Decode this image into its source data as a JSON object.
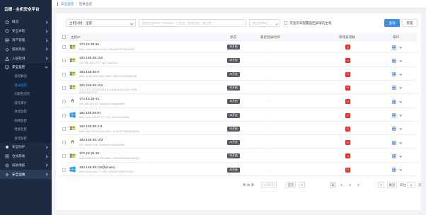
{
  "sidebar": {
    "brand": "云眼 · 主机安全平台",
    "items": [
      {
        "label": "概况",
        "icon": "home-icon"
      },
      {
        "label": "安全体检",
        "icon": "shield-check-icon"
      },
      {
        "label": "资产管理",
        "icon": "asset-icon"
      },
      {
        "label": "漏洞风险",
        "icon": "bug-icon"
      },
      {
        "label": "入侵检测",
        "icon": "alert-icon"
      }
    ],
    "open_item": {
      "label": "安全监控",
      "icon": "monitor-icon"
    },
    "sub_items": [
      {
        "label": "·监控概况",
        "active": false
      },
      {
        "label": "·登录监控",
        "active": true
      },
      {
        "label": "·问题性监控",
        "active": false
      },
      {
        "label": "·操作审计",
        "active": false
      },
      {
        "label": "·进程监控",
        "active": false
      },
      {
        "label": "·网络监控",
        "active": false
      },
      {
        "label": "·性能监控",
        "active": false
      },
      {
        "label": "·会话监控",
        "active": false
      }
    ],
    "bottom_items": [
      {
        "label": "安全防护",
        "icon": "defense-icon"
      },
      {
        "label": "合规基线",
        "icon": "baseline-icon"
      },
      {
        "label": "威胁情报",
        "icon": "intel-icon"
      },
      {
        "label": "安全运维",
        "icon": "ops-icon"
      }
    ]
  },
  "breadcrumb": {
    "parent": "安全监控",
    "separator": "/",
    "current": "登录监控"
  },
  "toolbar": {
    "select_value": "主机分组：全部",
    "search_placeholder": "搜索主机IP/IP (公/内网)，主机名，系统内容，备注等",
    "time_placeholder": "最近登录时",
    "checkbox_label": "仅显示未配置监控异常的主机",
    "query_button": "查询",
    "reset_button": "重置"
  },
  "table": {
    "headers": {
      "host": "主机IP",
      "status": "状态",
      "last_login": "最近登录时间",
      "risk": "新增异常数",
      "ops": "操作"
    },
    "rows": [
      {
        "os": "windows",
        "ip": "172.16.39.35",
        "sub": "fe80::10d8:e8b0:cf7f:c5 / WIN-6B7PF7IDUHDE",
        "wrap": false,
        "status": "未开启",
        "last": "-",
        "risk": "0"
      },
      {
        "os": "windows",
        "ip": "192.168.88.118",
        "sub": "192.168.183.1/71 / vg-77/a47/c17",
        "wrap": false,
        "status": "未开启",
        "last": "-",
        "risk": "0"
      },
      {
        "os": "windows",
        "ip": "192.168.89.6",
        "sub": "fe80::3046:25ce:28b7:bd82 / WIN-D7L9DL56G0S",
        "wrap": false,
        "status": "未开启",
        "last": "-",
        "risk": "0"
      },
      {
        "os": "windows",
        "ip": "192.168.88.118",
        "sub": "1111:2222:3333:4444:611c:4bb8:8cc8:d13e / WIN-8VCF1GC5TQT",
        "wrap": true,
        "status": "未开启",
        "last": "-",
        "risk": "0"
      },
      {
        "os": "linux",
        "ip": "172.16.39.44",
        "sub": "192.168.145.41 / localhost.localdomain",
        "wrap": false,
        "status": "未开启",
        "last": "-",
        "risk": "0"
      },
      {
        "os": "windows10",
        "ip": "192.168.89.97",
        "sub": "fe80::5c3c:b40c:77:97 / PC-201904261658",
        "wrap": false,
        "status": "未开启",
        "last": "-",
        "risk": "0"
      },
      {
        "os": "windows",
        "ip": "192.168.89.211",
        "sub": "fe80::e5a7:9b75:94b4:4291 / WIN-9T7QWKHQBAR",
        "wrap": false,
        "status": "未开启",
        "last": "-",
        "risk": "0"
      },
      {
        "os": "linux",
        "ip": "192.168.88.103",
        "sub": "192.168.88.194 / localhost.localdomain",
        "wrap": false,
        "status": "未开启",
        "last": "-",
        "risk": "0"
      },
      {
        "os": "windows",
        "ip": "172.16.39.38",
        "sub": "fe80::9059:b435:2164:5b82 / WIN-M63EMAYMENR",
        "wrap": false,
        "status": "未开启",
        "last": "-",
        "risk": "0"
      },
      {
        "os": "windows10",
        "ip": "192.168.89.150(bd-win)",
        "sub": "fe80::5c3c:b40c:77:198 / WIN-EP3ZMF87E8M",
        "wrap": false,
        "status": "未开启",
        "last": "-",
        "risk": "0"
      }
    ]
  },
  "pagination": {
    "total": "共 35 条",
    "page_size": "10 条/页",
    "first": "首页",
    "prev": "<",
    "pages": [
      "1",
      "2",
      "3",
      "4"
    ],
    "active_page": "1",
    "next": ">",
    "last": "尾页",
    "goto_label": "前往",
    "goto_value": "1",
    "goto_unit": "页"
  },
  "colors": {
    "sidebar_bg": "#1c2b41",
    "accent": "#3a8ee6",
    "status_off": "#555a63",
    "risk_badge": "#e5322d"
  }
}
